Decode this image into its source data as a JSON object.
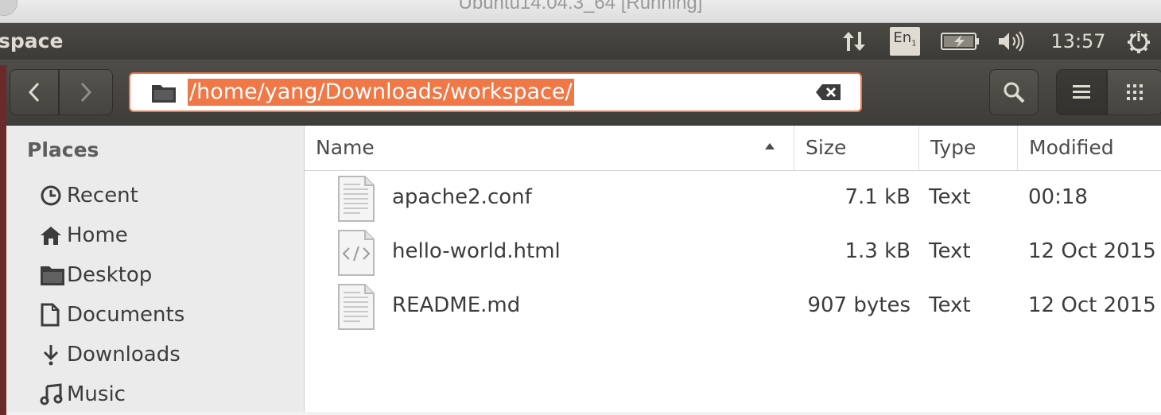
{
  "host_window": {
    "title": "Ubuntu14.04.3_64 [Running]"
  },
  "top_panel": {
    "app_title": "space",
    "keyboard_indicator": "En",
    "keyboard_indicator_sub": "1",
    "clock": "13:57",
    "icons": [
      "network-updown-icon",
      "battery-charging-icon",
      "volume-icon",
      "power-gear-icon"
    ]
  },
  "header_bar": {
    "location": "/home/yang/Downloads/workspace/",
    "accent_color": "#f07746"
  },
  "sidebar": {
    "heading": "Places",
    "items": [
      {
        "label": "Recent",
        "icon": "clock-icon"
      },
      {
        "label": "Home",
        "icon": "home-icon"
      },
      {
        "label": "Desktop",
        "icon": "folder-icon"
      },
      {
        "label": "Documents",
        "icon": "document-icon"
      },
      {
        "label": "Downloads",
        "icon": "download-icon"
      },
      {
        "label": "Music",
        "icon": "music-icon"
      }
    ]
  },
  "file_list": {
    "columns": [
      "Name",
      "Size",
      "Type",
      "Modified"
    ],
    "sort": {
      "column": "Name",
      "direction": "ascending"
    },
    "rows": [
      {
        "name": "apache2.conf",
        "size": "7.1 kB",
        "type": "Text",
        "modified": "00:18",
        "icon": "text-file-icon"
      },
      {
        "name": "hello-world.html",
        "size": "1.3 kB",
        "type": "Text",
        "modified": "12 Oct 2015",
        "icon": "html-file-icon"
      },
      {
        "name": "README.md",
        "size": "907 bytes",
        "type": "Text",
        "modified": "12 Oct 2015",
        "icon": "text-file-icon"
      }
    ]
  }
}
